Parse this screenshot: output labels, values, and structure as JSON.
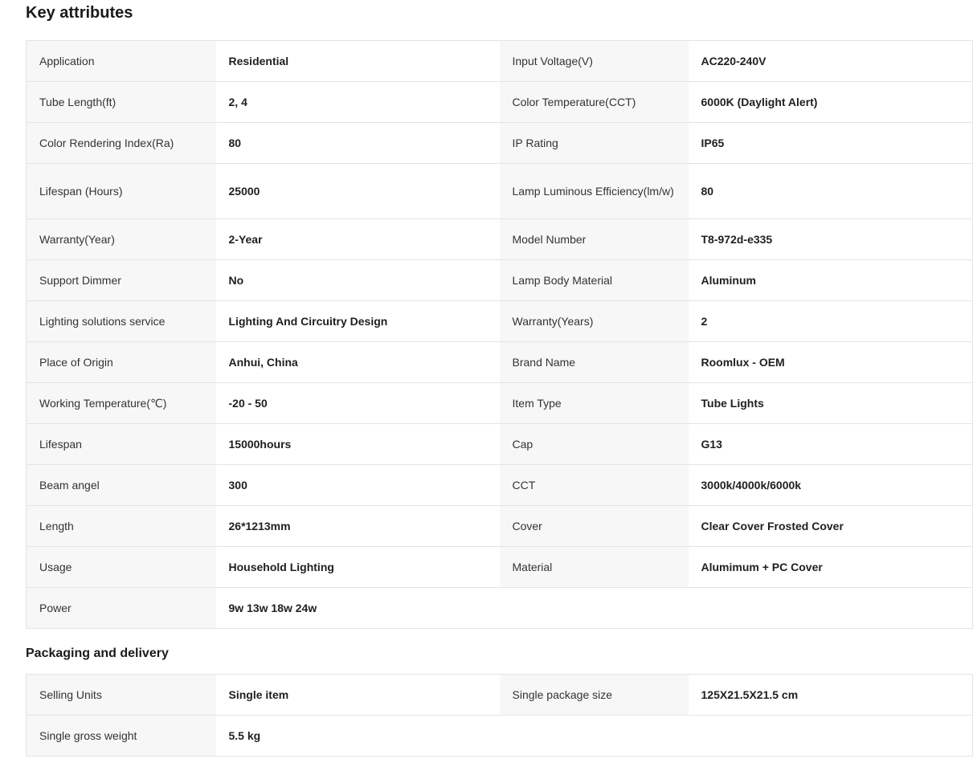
{
  "key_attributes": {
    "title": "Key attributes",
    "rows": [
      [
        {
          "label": "Application",
          "value": "Residential"
        },
        {
          "label": "Input Voltage(V)",
          "value": "AC220-240V"
        }
      ],
      [
        {
          "label": "Tube Length(ft)",
          "value": "2, 4"
        },
        {
          "label": "Color Temperature(CCT)",
          "value": "6000K (Daylight Alert)"
        }
      ],
      [
        {
          "label": "Color Rendering Index(Ra)",
          "value": "80"
        },
        {
          "label": "IP Rating",
          "value": "IP65"
        }
      ],
      [
        {
          "label": "Lifespan (Hours)",
          "value": "25000"
        },
        {
          "label": "Lamp Luminous Efficiency(lm/w)",
          "value": "80"
        }
      ],
      [
        {
          "label": "Warranty(Year)",
          "value": "2-Year"
        },
        {
          "label": "Model Number",
          "value": "T8-972d-e335"
        }
      ],
      [
        {
          "label": "Support Dimmer",
          "value": "No"
        },
        {
          "label": "Lamp Body Material",
          "value": "Aluminum"
        }
      ],
      [
        {
          "label": "Lighting solutions service",
          "value": "Lighting And Circuitry Design"
        },
        {
          "label": "Warranty(Years)",
          "value": "2"
        }
      ],
      [
        {
          "label": "Place of Origin",
          "value": "Anhui, China"
        },
        {
          "label": "Brand Name",
          "value": "Roomlux - OEM"
        }
      ],
      [
        {
          "label": "Working Temperature(℃)",
          "value": "-20 - 50"
        },
        {
          "label": "Item Type",
          "value": "Tube Lights"
        }
      ],
      [
        {
          "label": "Lifespan",
          "value": "15000hours"
        },
        {
          "label": "Cap",
          "value": "G13"
        }
      ],
      [
        {
          "label": "Beam angel",
          "value": "300"
        },
        {
          "label": "CCT",
          "value": "3000k/4000k/6000k"
        }
      ],
      [
        {
          "label": "Length",
          "value": "26*1213mm"
        },
        {
          "label": "Cover",
          "value": "Clear Cover Frosted Cover"
        }
      ],
      [
        {
          "label": "Usage",
          "value": "Household Lighting"
        },
        {
          "label": "Material",
          "value": "Alumimum + PC Cover"
        }
      ],
      [
        {
          "label": "Power",
          "value": "9w 13w 18w 24w"
        }
      ]
    ]
  },
  "packaging": {
    "title": "Packaging and delivery",
    "rows": [
      [
        {
          "label": "Selling Units",
          "value": "Single item"
        },
        {
          "label": "Single package size",
          "value": "125X21.5X21.5 cm"
        }
      ],
      [
        {
          "label": "Single gross weight",
          "value": "5.5 kg"
        }
      ]
    ]
  }
}
